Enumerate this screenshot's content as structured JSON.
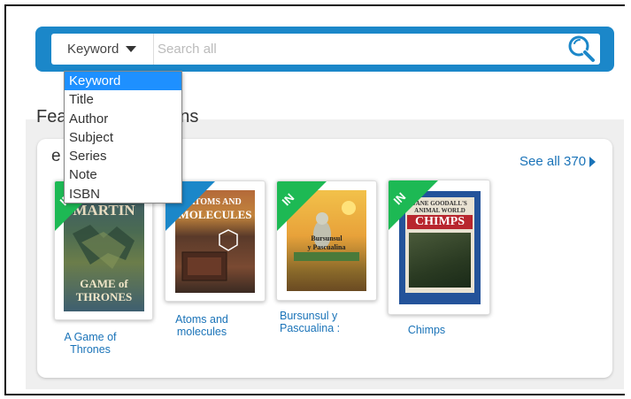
{
  "search": {
    "type_selected": "Keyword",
    "placeholder": "Search all",
    "type_options": [
      "Keyword",
      "Title",
      "Author",
      "Subject",
      "Series",
      "Note",
      "ISBN"
    ]
  },
  "featured": {
    "title": "Featured Collections",
    "section_title": "e",
    "see_all": "See all 370"
  },
  "books": [
    {
      "title": "A Game of Thrones",
      "badge": "IN",
      "cover_line1": "MARTIN",
      "cover_line2": "GAME of",
      "cover_line3": "THRONES"
    },
    {
      "title": "Atoms and molecules",
      "badge": "",
      "cover_line1": "ATOMS AND",
      "cover_line2": "MOLECULES"
    },
    {
      "title": "Bursunsul y Pascualina :",
      "badge": "IN",
      "cover_line1": "Bursunsul",
      "cover_line2": "y Pascualina"
    },
    {
      "title": "Chimps",
      "badge": "IN",
      "cover_line1": "JANE GOODALL'S",
      "cover_line2": "ANIMAL WORLD",
      "cover_line3": "CHIMPS"
    }
  ],
  "colors": {
    "accent": "#1b87c9",
    "badge_green": "#1db954",
    "link": "#1a73b8"
  }
}
